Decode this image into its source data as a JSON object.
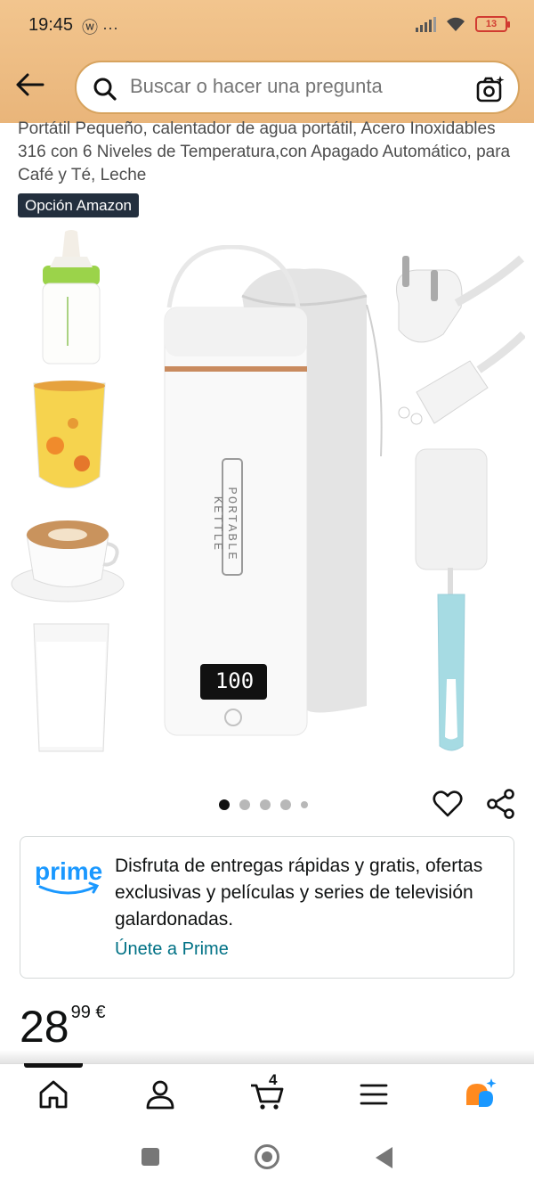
{
  "status_bar": {
    "time": "19:45",
    "left_icons": "ⓦ ···",
    "battery": "13"
  },
  "header": {
    "search_placeholder": "Buscar o hacer una pregunta"
  },
  "product": {
    "title": "Portátil Pequeño, calentador de agua portátil, Acero Inoxidables 316 con 6 Niveles de Temperatura,con Apagado Automático, para Café y Té, Leche",
    "badge": "Opción Amazon",
    "kettle_label": "PORTABLE KETTLE",
    "display_value": "100",
    "gallery_page": 1,
    "gallery_total": 5
  },
  "prime": {
    "logo_text": "prime",
    "message": "Disfruta de entregas rápidas y gratis, ofertas exclusivas y películas y series de televisión galardonadas.",
    "link": "Únete a Prime"
  },
  "price": {
    "whole": "28",
    "fraction": "99 €"
  },
  "bottom_nav": {
    "cart_count": "4",
    "items": [
      "home-icon",
      "account-icon",
      "cart-icon",
      "menu-icon",
      "rufus-icon"
    ]
  },
  "colors": {
    "header_bg": "#eebf86",
    "prime_blue": "#1a98ff",
    "link": "#007185",
    "badge_bg": "#232f3e"
  }
}
